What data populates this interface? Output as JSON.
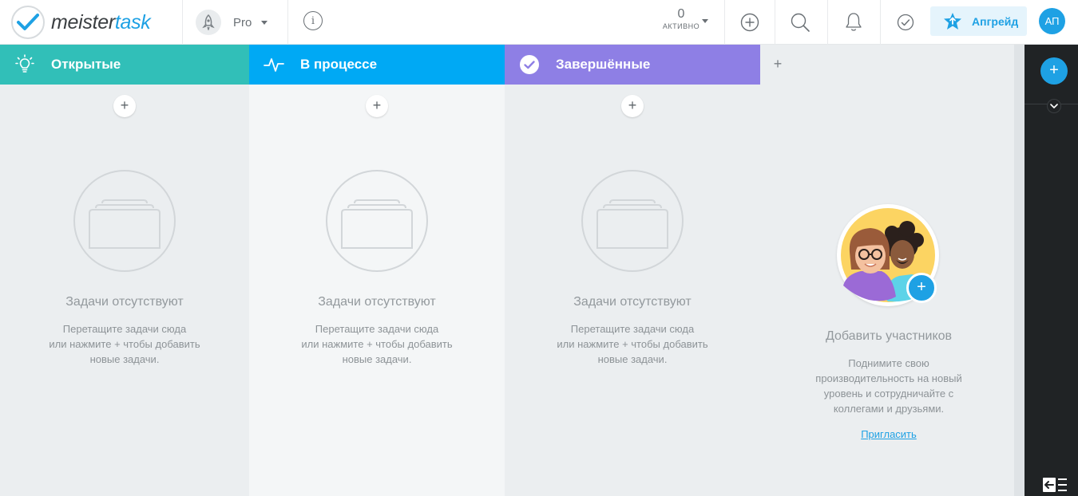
{
  "app": {
    "logo_text_1": "meister",
    "logo_text_2": "task"
  },
  "topbar": {
    "plan_label": "Pro",
    "info_label": "i",
    "active_count": "0",
    "active_label": "АКТИВНО",
    "upgrade_label": "Апгрейд",
    "avatar_initials": "АП",
    "icons": [
      "plus-circle-icon",
      "search-icon",
      "bell-icon",
      "check-circle-icon",
      "star-upgrade-icon"
    ]
  },
  "columns": [
    {
      "title": "Открытые",
      "icon": "lightbulb-icon",
      "color": "#31bfb8",
      "add_label": "+",
      "empty_title": "Задачи отсутствуют",
      "empty_desc_1": "Перетащите задачи сюда",
      "empty_desc_2": "или нажмите + чтобы добавить",
      "empty_desc_3": "новые задачи."
    },
    {
      "title": "В процессе",
      "icon": "activity-pulse-icon",
      "color": "#00a9f4",
      "add_label": "+",
      "empty_title": "Задачи отсутствуют",
      "empty_desc_1": "Перетащите задачи сюда",
      "empty_desc_2": "или нажмите + чтобы добавить",
      "empty_desc_3": "новые задачи."
    },
    {
      "title": "Завершённые",
      "icon": "check-circle-icon",
      "color": "#8e7fe5",
      "add_label": "+",
      "empty_title": "Задачи отсутствуют",
      "empty_desc_1": "Перетащите задачи сюда",
      "empty_desc_2": "или нажмите + чтобы добавить",
      "empty_desc_3": "новые задачи."
    }
  ],
  "add_section_label": "+",
  "invite": {
    "plus_label": "+",
    "title": "Добавить участников",
    "desc_1": "Поднимите свою",
    "desc_2": "производительность на новый",
    "desc_3": "уровень и сотрудничайте с",
    "desc_4": "коллегами и друзьями.",
    "link": "Пригласить"
  },
  "dock": {
    "add_label": "+"
  },
  "colors": {
    "accent": "#1ea1e4",
    "open": "#31bfb8",
    "in_progress": "#00a9f4",
    "done": "#8e7fe5",
    "dock": "#202325"
  }
}
